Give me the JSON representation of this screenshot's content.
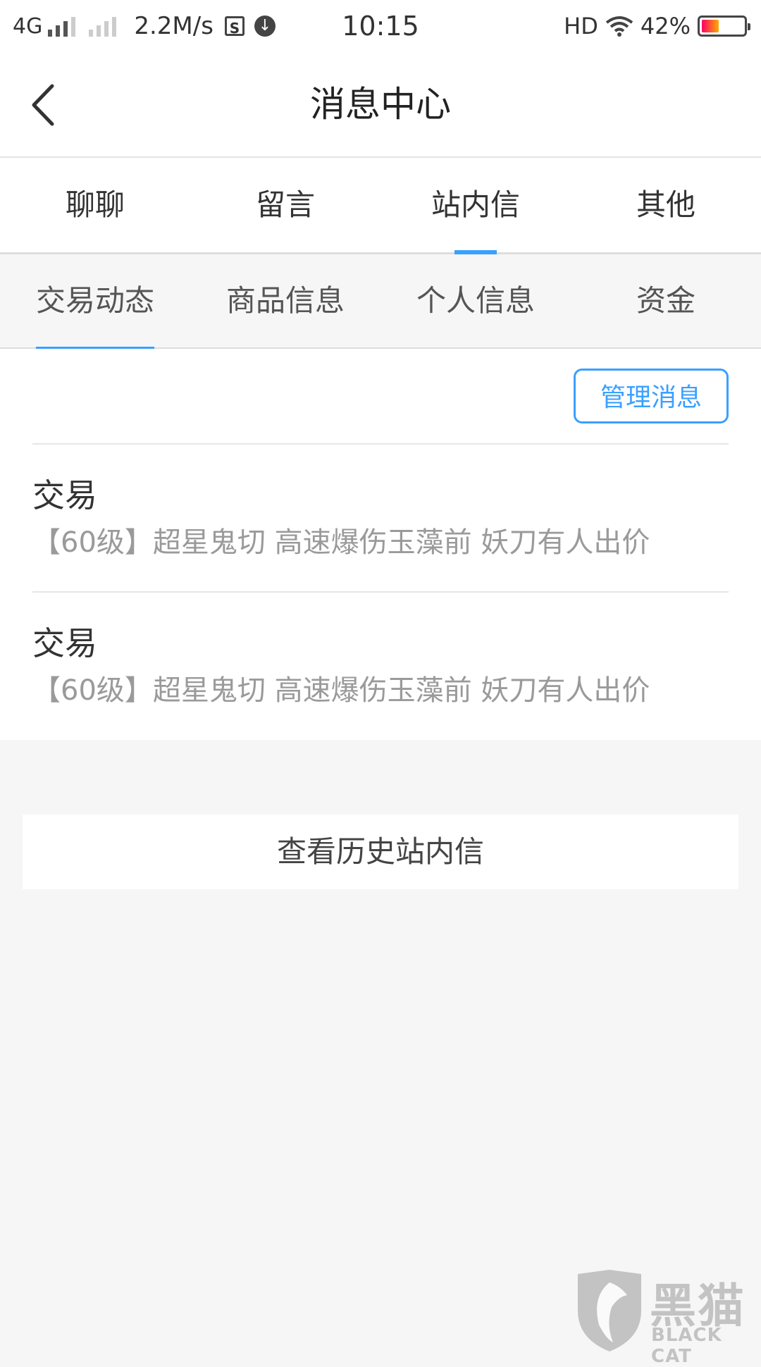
{
  "status_bar": {
    "network": "4G",
    "speed": "2.2M/s",
    "time": "10:15",
    "hd": "HD",
    "battery": "42%",
    "battery_level": 0.42
  },
  "header": {
    "title": "消息中心"
  },
  "tabs": [
    {
      "label": "聊聊",
      "active": false
    },
    {
      "label": "留言",
      "active": false
    },
    {
      "label": "站内信",
      "active": true
    },
    {
      "label": "其他",
      "active": false
    }
  ],
  "subtabs": [
    {
      "label": "交易动态",
      "active": true
    },
    {
      "label": "商品信息",
      "active": false
    },
    {
      "label": "个人信息",
      "active": false
    },
    {
      "label": "资金",
      "active": false
    }
  ],
  "manage_button": "管理消息",
  "messages": [
    {
      "title": "交易",
      "body": "【60级】超星鬼切 高速爆伤玉藻前 妖刀有人出价"
    },
    {
      "title": "交易",
      "body": "【60级】超星鬼切 高速爆伤玉藻前 妖刀有人出价"
    }
  ],
  "history_button": "查看历史站内信",
  "watermark": {
    "text": "黑猫",
    "sub": "BLACK CAT"
  },
  "colors": {
    "accent": "#3aa0ff",
    "background": "#f6f6f6"
  }
}
